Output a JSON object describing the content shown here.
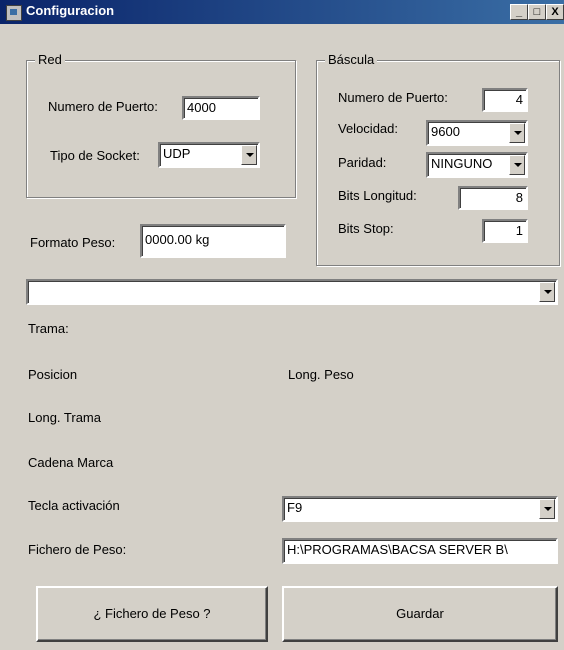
{
  "window": {
    "title": "Configuracion",
    "minimize": "_",
    "maximize": "□",
    "close": "X"
  },
  "red": {
    "legend": "Red",
    "puerto_label": "Numero de Puerto:",
    "puerto_value": "4000",
    "socket_label": "Tipo de Socket:",
    "socket_value": "UDP"
  },
  "formato": {
    "label": "Formato Peso:",
    "value": "0000.00 kg"
  },
  "bascula": {
    "legend": "Báscula",
    "puerto_label": "Numero de Puerto:",
    "puerto_value": "4",
    "velocidad_label": "Velocidad:",
    "velocidad_value": "9600",
    "paridad_label": "Paridad:",
    "paridad_value": "NINGUNO",
    "bits_longitud_label": "Bits Longitud:",
    "bits_longitud_value": "8",
    "bits_stop_label": "Bits Stop:",
    "bits_stop_value": "1"
  },
  "main_combo": {
    "value": ""
  },
  "labels": {
    "trama": "Trama:",
    "posicion": "Posicion",
    "long_peso": "Long. Peso",
    "long_trama": "Long. Trama",
    "cadena_marca": "Cadena Marca",
    "tecla_activacion": "Tecla activación",
    "fichero_peso": "Fichero de Peso:"
  },
  "tecla": {
    "value": "F9"
  },
  "fichero": {
    "value": "H:\\PROGRAMAS\\BACSA SERVER B\\"
  },
  "buttons": {
    "fichero": "¿ Fichero de Peso ?",
    "guardar": "Guardar"
  }
}
